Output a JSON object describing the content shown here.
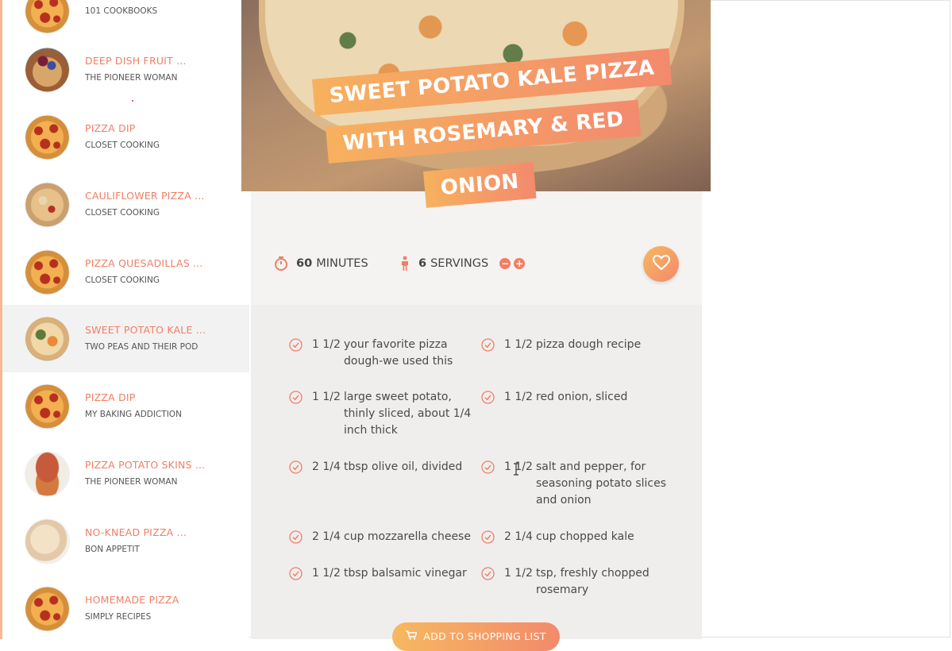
{
  "sidebar": {
    "items": [
      {
        "title": "",
        "source": "101 COOKBOOKS",
        "thumb": "pizza-thumbnail"
      },
      {
        "title": "DEEP DISH FRUIT ...",
        "source": "THE PIONEER WOMAN",
        "thumb": "fruit-dessert-thumbnail"
      },
      {
        "title": "PIZZA DIP",
        "source": "CLOSET COOKING",
        "thumb": "pizza-dip-thumbnail"
      },
      {
        "title": "CAULIFLOWER PIZZA ...",
        "source": "CLOSET COOKING",
        "thumb": "cauliflower-pizza-thumbnail"
      },
      {
        "title": "PIZZA QUESADILLAS ...",
        "source": "CLOSET COOKING",
        "thumb": "quesadilla-thumbnail"
      },
      {
        "title": "SWEET POTATO KALE ...",
        "source": "TWO PEAS AND THEIR POD",
        "thumb": "kale-pizza-thumbnail",
        "active": true
      },
      {
        "title": "PIZZA DIP",
        "source": "MY BAKING ADDICTION",
        "thumb": "pizza-dip-thumbnail"
      },
      {
        "title": "PIZZA POTATO SKINS ...",
        "source": "THE PIONEER WOMAN",
        "thumb": "potato-skins-thumbnail"
      },
      {
        "title": "NO-KNEAD PIZZA ...",
        "source": "BON APPETIT",
        "thumb": "dough-thumbnail"
      },
      {
        "title": "HOMEMADE PIZZA",
        "source": "SIMPLY RECIPES",
        "thumb": "pizza-thumbnail"
      }
    ]
  },
  "recipe": {
    "title_line1": "SWEET POTATO KALE PIZZA",
    "title_line2": "WITH ROSEMARY & RED",
    "title_line3": "ONION",
    "time_value": "60",
    "time_unit": "MINUTES",
    "servings_value": "6",
    "servings_unit": "SERVINGS",
    "ingredients": [
      {
        "qty": "1 1/2",
        "lines": [
          "your favorite pizza",
          "dough-we used this"
        ]
      },
      {
        "qty": "1 1/2",
        "lines": [
          "pizza dough recipe"
        ]
      },
      {
        "qty": "1 1/2",
        "lines": [
          "large sweet potato,",
          "thinly sliced, about 1/4",
          "inch thick"
        ]
      },
      {
        "qty": "1 1/2",
        "lines": [
          "red onion, sliced"
        ]
      },
      {
        "qty": "2 1/4",
        "lines": [
          "tbsp olive oil, divided"
        ]
      },
      {
        "qty": "1 1/2",
        "lines": [
          "salt and pepper, for",
          "seasoning potato slices",
          "and onion"
        ]
      },
      {
        "qty": "2 1/4",
        "lines": [
          "cup mozzarella cheese"
        ]
      },
      {
        "qty": "2 1/4",
        "lines": [
          "cup chopped kale"
        ]
      },
      {
        "qty": "1 1/2",
        "lines": [
          "tbsp balsamic vinegar"
        ]
      },
      {
        "qty": "1 1/2",
        "lines": [
          "tsp, freshly chopped",
          "rosemary"
        ]
      }
    ],
    "shopping_button": "ADD TO SHOPPING LIST"
  },
  "colors": {
    "accent": "#ef7f64",
    "gradient_start": "#f7b860",
    "gradient_end": "#f28a6b"
  }
}
